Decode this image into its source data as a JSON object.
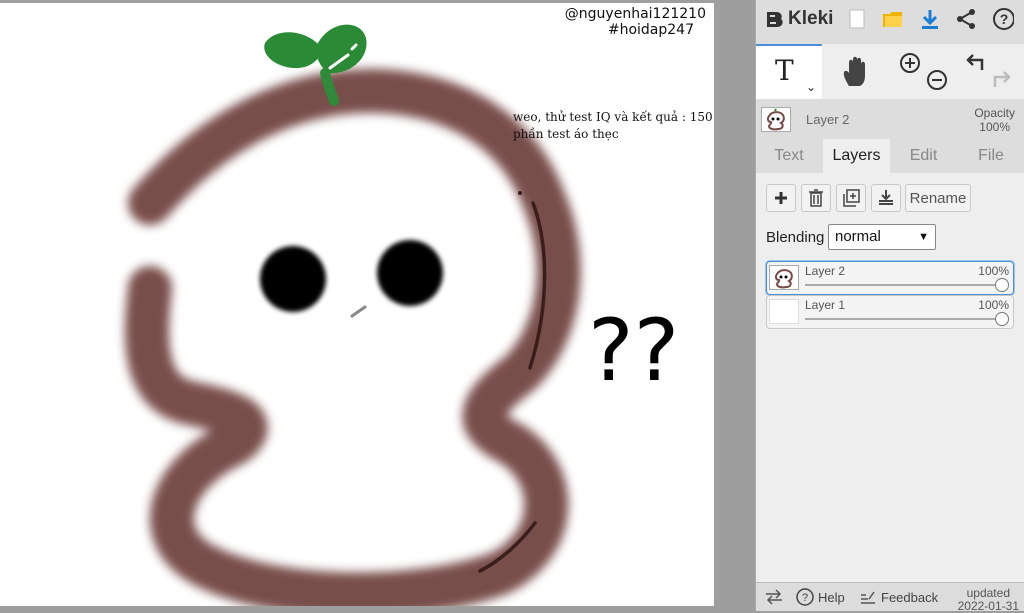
{
  "canvas": {
    "watermark_line1": "@nguyenhai121210",
    "watermark_line2": "#hoidap247",
    "note_text": "weo, thử test IQ và kết quả : 150 phần test áo thẹc",
    "question_marks": "??"
  },
  "app": {
    "name": "Kleki"
  },
  "toolbar": {
    "icons": [
      "new-file-icon",
      "open-folder-icon",
      "download-icon",
      "share-icon",
      "help-icon"
    ],
    "accent_color": "#1a7fd4",
    "folder_color": "#f0b400"
  },
  "tools": {
    "active_tool_glyph": "T",
    "items": [
      "text-tool",
      "hand-tool",
      "zoom-in",
      "zoom-out",
      "undo",
      "redo"
    ]
  },
  "current_layer": {
    "name": "Layer 2",
    "opacity_label": "Opacity",
    "opacity_value": "100%"
  },
  "tabs": [
    {
      "label": "Text",
      "active": false
    },
    {
      "label": "Layers",
      "active": true
    },
    {
      "label": "Edit",
      "active": false
    },
    {
      "label": "File",
      "active": false
    }
  ],
  "layers_panel": {
    "rename_label": "Rename",
    "blending_label": "Blending",
    "blending_value": "normal",
    "layers": [
      {
        "name": "Layer 2",
        "opacity": "100%",
        "opacity_value": 1.0,
        "active": true
      },
      {
        "name": "Layer 1",
        "opacity": "100%",
        "opacity_value": 1.0,
        "active": false
      }
    ]
  },
  "footer": {
    "help_label": "Help",
    "feedback_label": "Feedback",
    "updated_label": "updated",
    "updated_date": "2022-01-31"
  }
}
